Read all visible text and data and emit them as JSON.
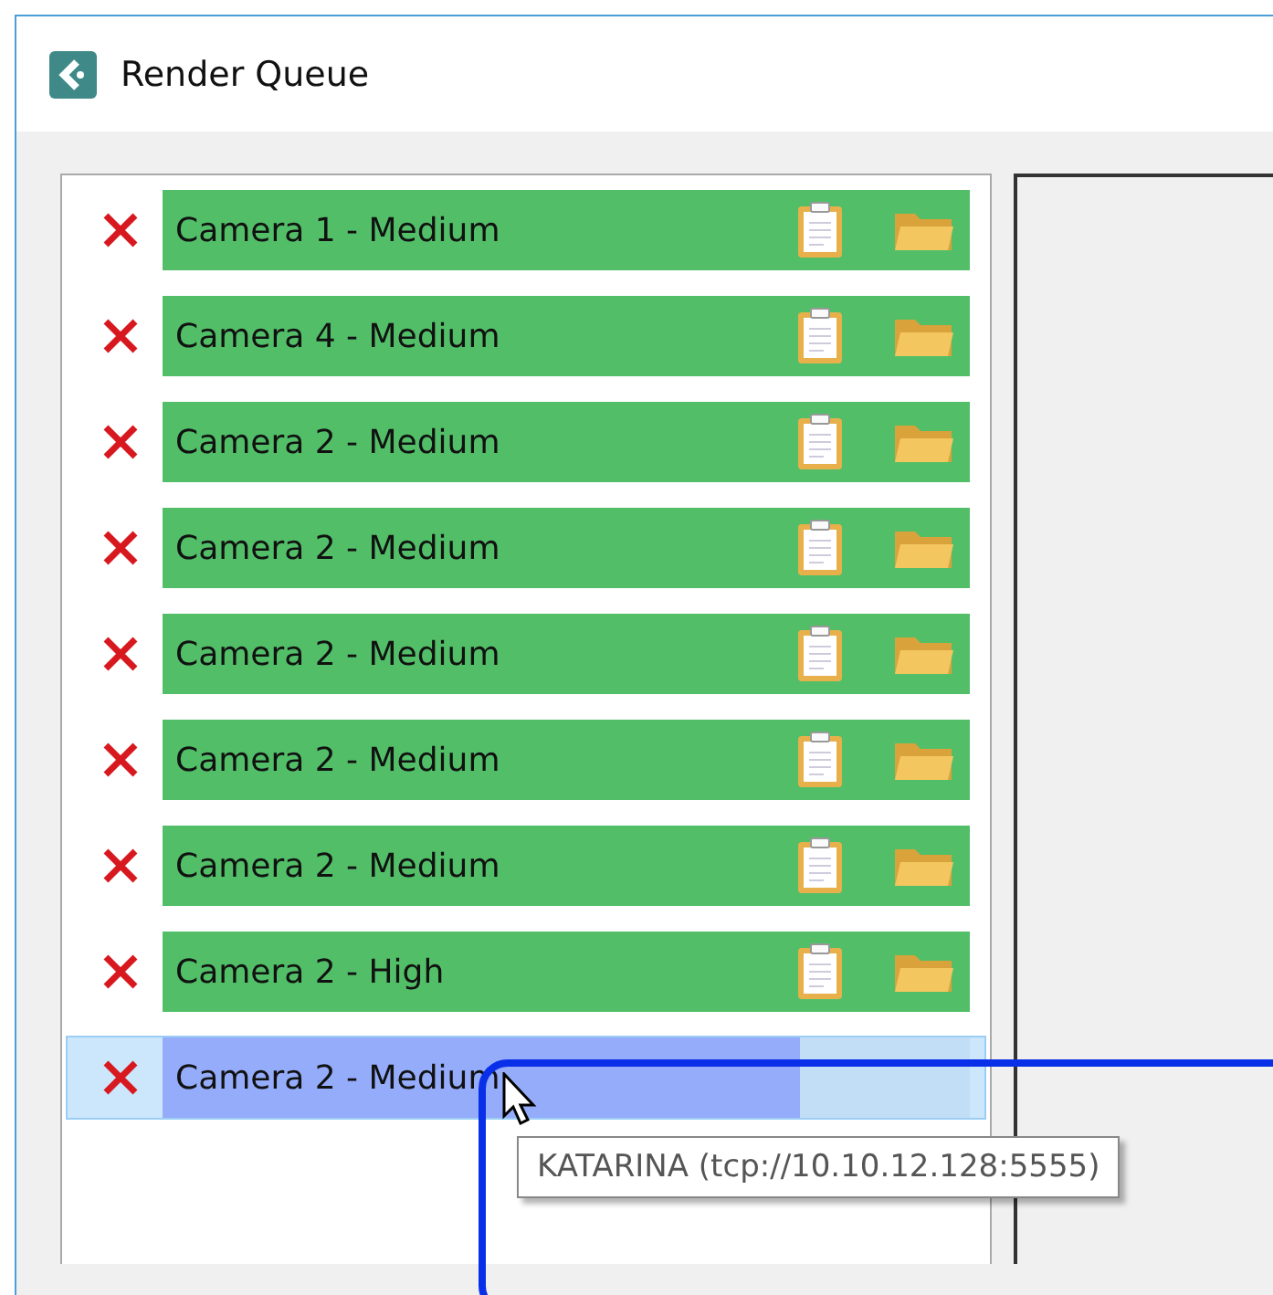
{
  "window": {
    "title": "Render Queue"
  },
  "jobs": [
    {
      "name": "Camera 1 - Medium",
      "complete": true,
      "selected": false
    },
    {
      "name": "Camera 4 - Medium",
      "complete": true,
      "selected": false
    },
    {
      "name": "Camera 2 - Medium",
      "complete": true,
      "selected": false
    },
    {
      "name": "Camera 2 - Medium",
      "complete": true,
      "selected": false
    },
    {
      "name": "Camera 2 - Medium",
      "complete": true,
      "selected": false
    },
    {
      "name": "Camera 2 - Medium",
      "complete": true,
      "selected": false
    },
    {
      "name": "Camera 2 - Medium",
      "complete": true,
      "selected": false
    },
    {
      "name": "Camera 2 - High",
      "complete": true,
      "selected": false
    },
    {
      "name": "Camera 2 - Medium",
      "complete": false,
      "selected": true,
      "level": 0.79
    }
  ],
  "tooltip": "KATARINA (tcp://10.10.12.128:5555)"
}
